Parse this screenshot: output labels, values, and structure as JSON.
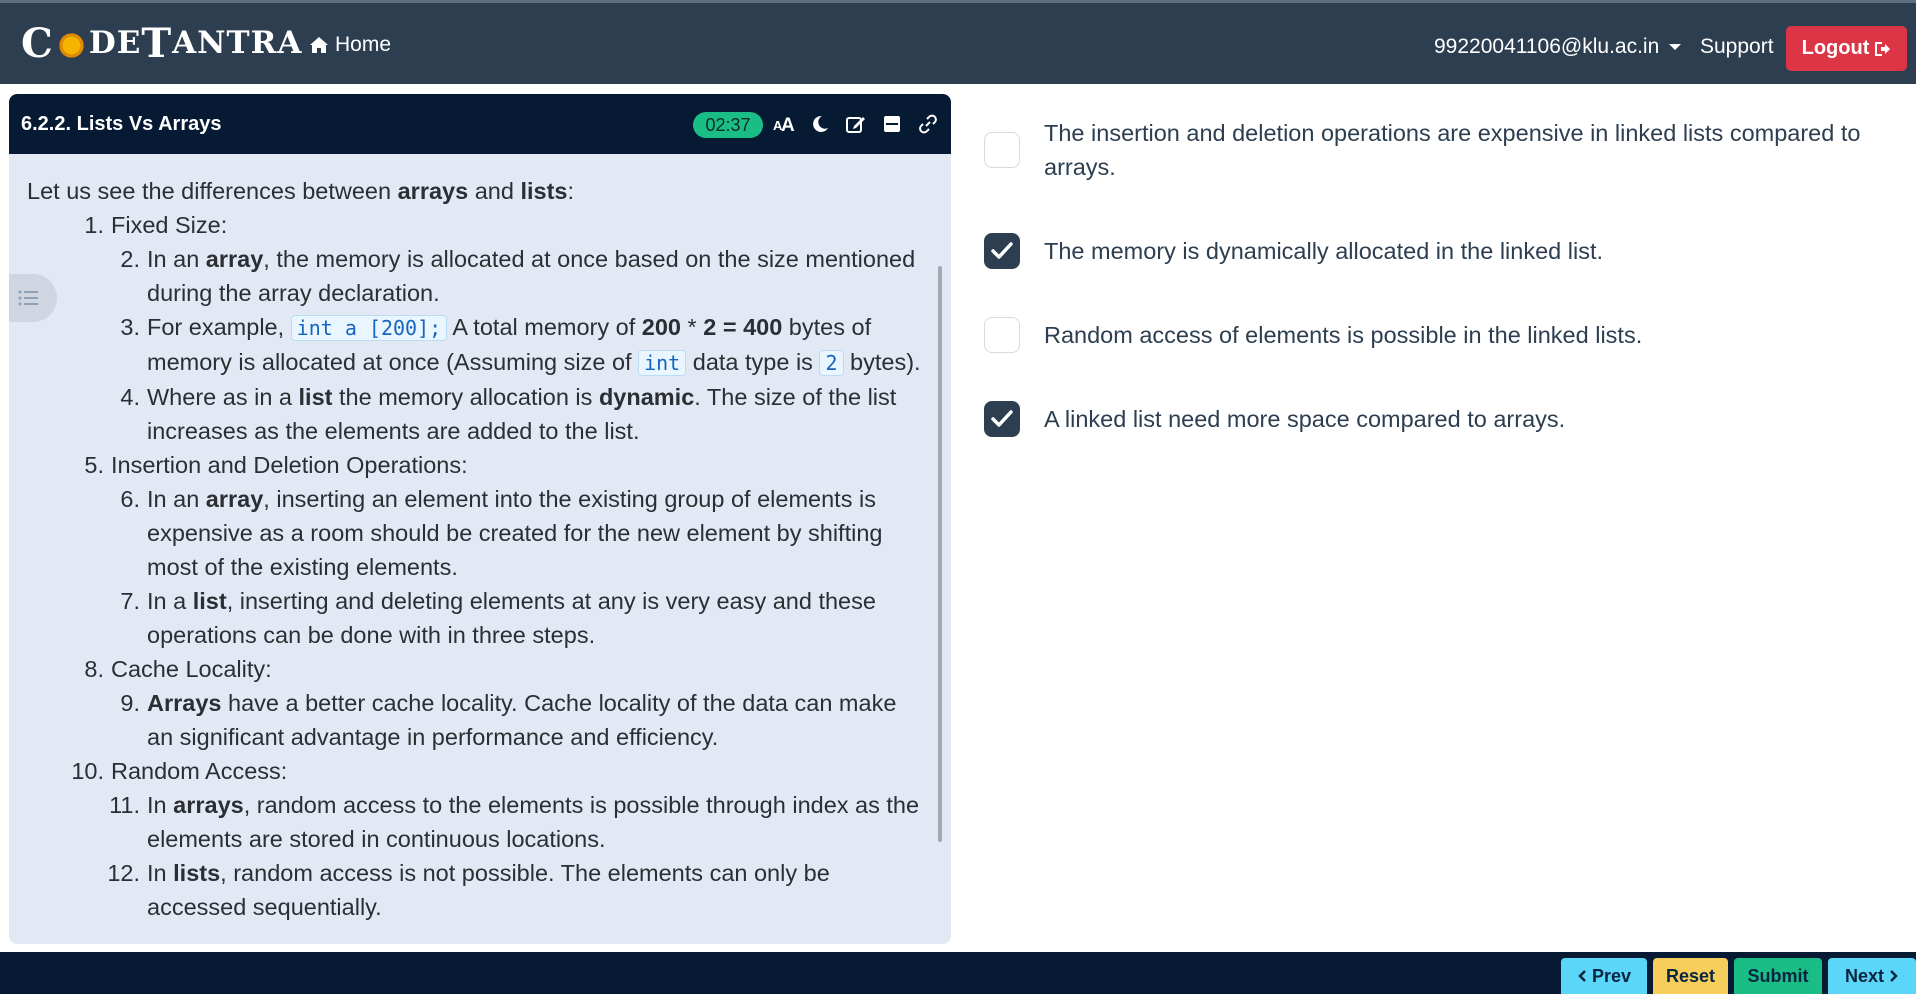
{
  "navbar": {
    "logo_c": "C",
    "logo_de": "DE",
    "logo_t": "T",
    "logo_antra": "ANTRA",
    "home_label": "Home",
    "user_email": "99220041106@klu.ac.in",
    "support_label": "Support",
    "logout_label": "Logout"
  },
  "lesson": {
    "title": "6.2.2. Lists Vs Arrays",
    "timer": "02:37",
    "intro": {
      "a": "Let us see the differences between ",
      "b": "arrays",
      "c": " and ",
      "d": "lists",
      "e": ":"
    },
    "items": {
      "i1": {
        "num": "1.",
        "text": "Fixed Size:"
      },
      "i2": {
        "num": "2.",
        "a": "In an ",
        "b": "array",
        "c": ", the memory is allocated at once based on the size mentioned during the array declaration."
      },
      "i3": {
        "num": "3.",
        "a": "For example, ",
        "code1": "int a [200];",
        "b": " A total memory of ",
        "c": "200",
        "d": " * ",
        "e": "2 = 400",
        "f": " bytes of memory is allocated at once (Assuming size of ",
        "code2": "int",
        "g": " data type is ",
        "code3": "2",
        "h": " bytes)."
      },
      "i4": {
        "num": "4.",
        "a": "Where as in a ",
        "b": "list",
        "c": " the memory allocation is ",
        "d": "dynamic",
        "e": ". The size of the list increases as the elements are added to the list."
      },
      "i5": {
        "num": "5.",
        "text": "Insertion and Deletion Operations:"
      },
      "i6": {
        "num": "6.",
        "a": "In an ",
        "b": "array",
        "c": ", inserting an element into the existing group of elements is expensive as a room should be created for the new element by shifting most of the existing elements."
      },
      "i7": {
        "num": "7.",
        "a": "In a ",
        "b": "list",
        "c": ", inserting and deleting elements at any is very easy and these operations can be done with in three steps."
      },
      "i8": {
        "num": "8.",
        "text": "Cache Locality:"
      },
      "i9": {
        "num": "9.",
        "a": "Arrays",
        "b": " have a better cache locality. Cache locality of the data can make an significant advantage in performance and efficiency."
      },
      "i10": {
        "num": "10.",
        "text": "Random Access:"
      },
      "i11": {
        "num": "11.",
        "a": "In ",
        "b": "arrays",
        "c": ", random access to the elements is possible through index as the elements are stored in continuous locations."
      },
      "i12": {
        "num": "12.",
        "a": "In ",
        "b": "lists",
        "c": ", random access is not possible. The elements can only be accessed sequentially."
      }
    }
  },
  "options": [
    {
      "text": "The insertion and deletion operations are expensive in linked lists compared to arrays.",
      "checked": false
    },
    {
      "text": "The memory is dynamically allocated in the linked list.",
      "checked": true
    },
    {
      "text": "Random access of elements is possible in the linked lists.",
      "checked": false
    },
    {
      "text": "A linked list need more space compared to arrays.",
      "checked": true
    }
  ],
  "footer": {
    "prev_label": "Prev",
    "reset_label": "Reset",
    "submit_label": "Submit",
    "next_label": "Next"
  },
  "colors": {
    "navbar": "#2c3e50",
    "panel_header": "#061a33",
    "timer": "#1bbd86",
    "logout": "#dc3545",
    "prev_next": "#5bd6f8",
    "reset": "#f7ce5b",
    "submit": "#1bbd86"
  }
}
